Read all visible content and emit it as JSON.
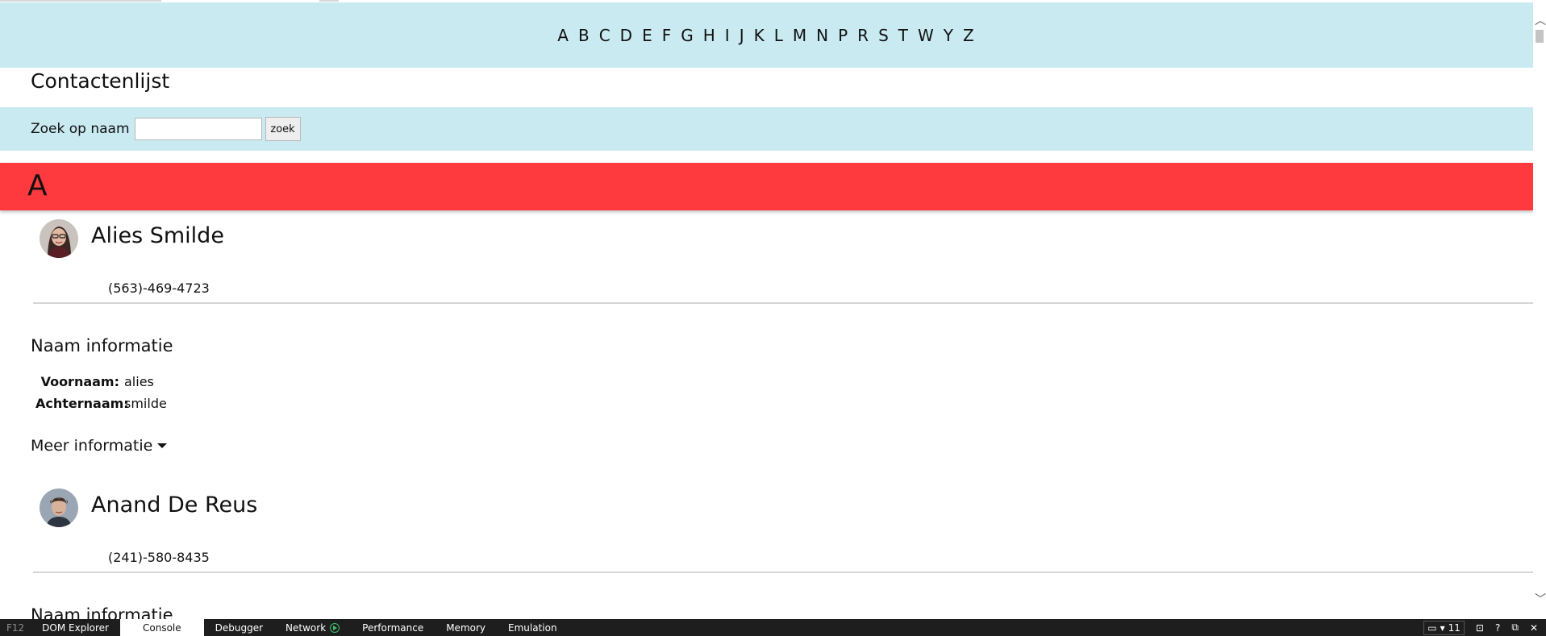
{
  "alphabet": [
    "A",
    "B",
    "C",
    "D",
    "E",
    "F",
    "G",
    "H",
    "I",
    "J",
    "K",
    "L",
    "M",
    "N",
    "P",
    "R",
    "S",
    "T",
    "W",
    "Y",
    "Z"
  ],
  "page_title": "Contactenlijst",
  "search": {
    "label": "Zoek op naam",
    "value": "",
    "placeholder": "",
    "button_label": "zoek"
  },
  "letter_header": "A",
  "contacts": [
    {
      "name": "Alies Smilde",
      "phone": "(563)-469-4723",
      "section_title": "Naam informatie",
      "first_name_label": "Voornaam:",
      "first_name": "alies",
      "last_name_label": "Achternaam:",
      "last_name": "smilde",
      "more_label": "Meer informatie"
    },
    {
      "name": "Anand De Reus",
      "phone": "(241)-580-8435",
      "section_title": "Naam informatie"
    }
  ],
  "devtools": {
    "f12": "F12",
    "tabs": [
      "DOM Explorer",
      "Console",
      "Debugger",
      "Network",
      "Performance",
      "Memory",
      "Emulation"
    ],
    "active_tab": "Console",
    "doc_mode": "11",
    "help": "?"
  },
  "colors": {
    "nav_bg": "#c9eaf1",
    "letter_header_bg": "#ff3a3f",
    "devtools_bg": "#1e1e1e"
  }
}
